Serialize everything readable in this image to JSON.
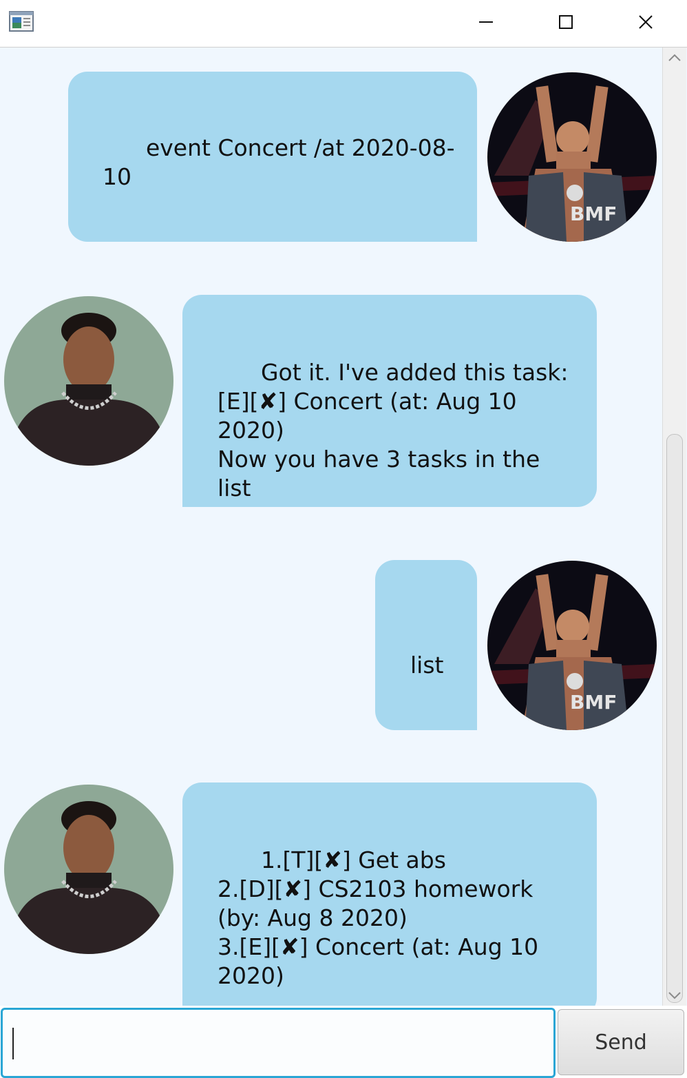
{
  "window": {
    "icon": "app-window-icon",
    "controls": [
      "minimize-icon",
      "maximize-icon",
      "close-icon"
    ]
  },
  "messages": [
    {
      "sender": "user",
      "avatar": "user-avatar-wrestler",
      "text": "event Concert /at 2020-08-10"
    },
    {
      "sender": "bot",
      "avatar": "bot-avatar-turtleneck",
      "text": "Got it. I've added this task:\n[E][✘] Concert (at: Aug 10\n2020)\nNow you have 3 tasks in the\nlist"
    },
    {
      "sender": "user",
      "avatar": "user-avatar-wrestler",
      "text": "list"
    },
    {
      "sender": "bot",
      "avatar": "bot-avatar-turtleneck",
      "text": "1.[T][✘] Get abs\n2.[D][✘] CS2103 homework\n(by: Aug 8 2020)\n3.[E][✘] Concert (at: Aug 10\n2020)"
    }
  ],
  "input": {
    "value": ""
  },
  "send_label": "Send",
  "colors": {
    "bubble": "#a6d8ef",
    "chat_background": "#f0f7fe",
    "input_border": "#2aa6d5"
  }
}
